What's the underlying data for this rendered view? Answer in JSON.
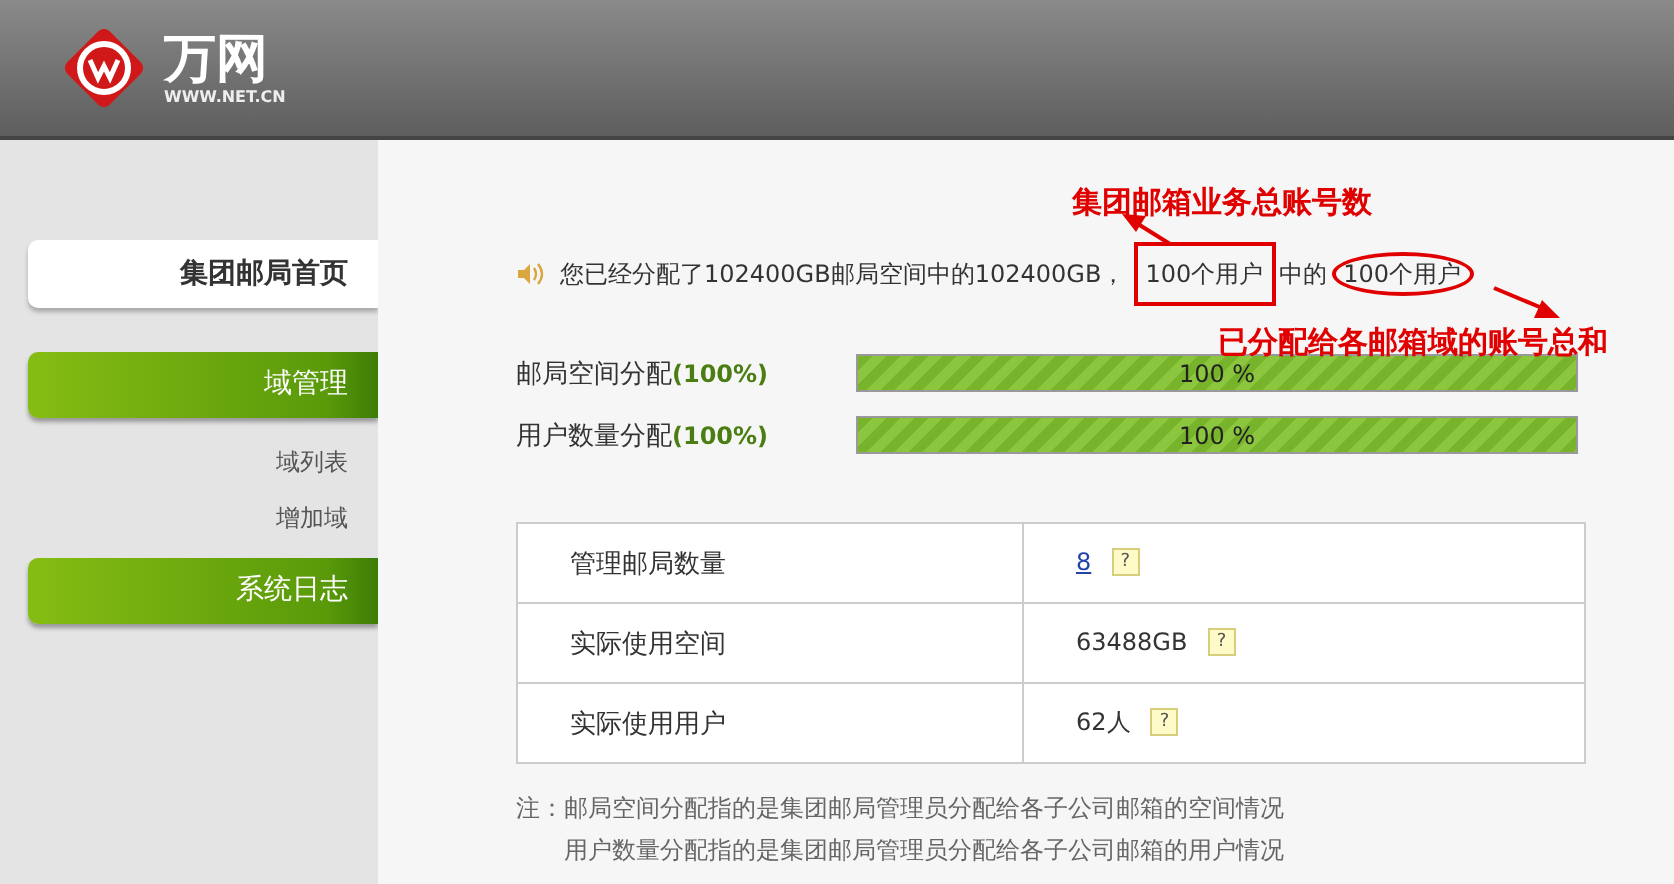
{
  "header": {
    "logo_name": "万网",
    "logo_url": "WWW.NET.CN"
  },
  "sidebar": {
    "items": [
      {
        "label": "集团邮局首页",
        "kind": "home",
        "selected": true
      },
      {
        "label": "域管理",
        "kind": "section",
        "selected": false
      },
      {
        "label": "域列表",
        "kind": "link",
        "selected": false
      },
      {
        "label": "增加域",
        "kind": "link",
        "selected": false
      },
      {
        "label": "系统日志",
        "kind": "section",
        "selected": false
      }
    ]
  },
  "summary": {
    "parts": [
      {
        "text": "您已经分配了102400GB邮局空间中的102400GB，",
        "boxed": false,
        "circled": false
      },
      {
        "text": "100个用户",
        "boxed": true,
        "circled": false
      },
      {
        "text": "中的",
        "boxed": false,
        "circled": false
      },
      {
        "text": "100个用户",
        "boxed": false,
        "circled": true
      }
    ]
  },
  "annotations": [
    {
      "text": "集团邮箱业务总账号数"
    },
    {
      "text": "已分配给各邮箱域的账号总和"
    }
  ],
  "meters": [
    {
      "label": "邮局空间分配",
      "percent": "(100%)",
      "level": 1,
      "reading": "100 %"
    },
    {
      "label": "用户数量分配",
      "percent": "(100%)",
      "level": 1,
      "reading": "100 %"
    }
  ],
  "stats": [
    {
      "name": "管理邮局数量",
      "value": "8",
      "kind": "link",
      "help": "?"
    },
    {
      "name": "实际使用空间",
      "value": "63488GB",
      "kind": "text",
      "help": "?"
    },
    {
      "name": "实际使用用户",
      "value": "62人",
      "kind": "text",
      "help": "?"
    }
  ],
  "notes": [
    {
      "prefix": "注：",
      "text": "邮局空间分配指的是集团邮局管理员分配给各子公司邮箱的空间情况"
    },
    {
      "text": "用户数量分配指的是集团邮局管理员分配给各子公司邮箱的用户情况"
    }
  ]
}
